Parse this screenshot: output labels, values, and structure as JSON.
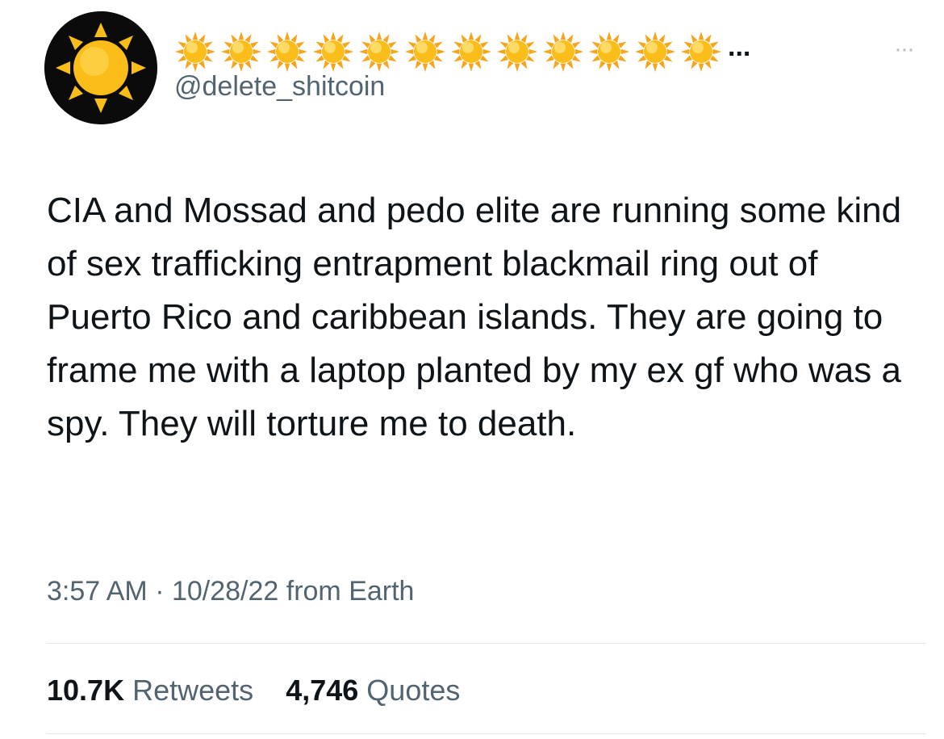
{
  "author": {
    "display_name_emoji": "sun-emoji",
    "display_name_emoji_count": 12,
    "display_name_truncation": "...",
    "handle": "@delete_shitcoin",
    "avatar_icon": "sun-icon"
  },
  "more_button": {
    "label": "···",
    "icon": "more-icon"
  },
  "tweet": {
    "text": "CIA and Mossad and pedo elite are running some kind of sex trafficking entrapment blackmail ring out of Puerto Rico and caribbean islands. They are going to frame me with a laptop planted by my ex gf who was a spy. They will torture me to death.",
    "timestamp": "3:57 AM · 10/28/22 from Earth"
  },
  "stats": {
    "retweets_count": "10.7K",
    "retweets_label": "Retweets",
    "quotes_count": "4,746",
    "quotes_label": "Quotes"
  },
  "colors": {
    "text_primary": "#0f1419",
    "text_secondary": "#536471",
    "divider": "#e3e6e8",
    "sun_yellow": "#fbbd1a",
    "avatar_bg": "#0b0b0b"
  }
}
